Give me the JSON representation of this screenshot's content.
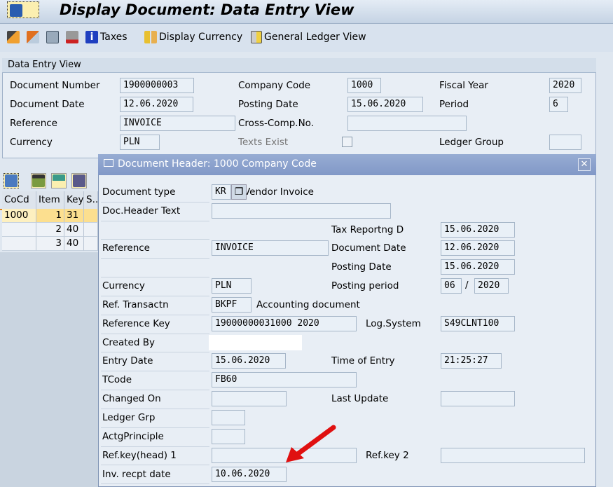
{
  "title": "Display Document: Data Entry View",
  "toolbar": {
    "taxes": "Taxes",
    "display_currency": "Display Currency",
    "gl_view": "General Ledger View"
  },
  "panel": {
    "heading": "Data Entry View",
    "document_number_label": "Document Number",
    "document_number": "1900000003",
    "company_code_label": "Company Code",
    "company_code": "1000",
    "fiscal_year_label": "Fiscal Year",
    "fiscal_year": "2020",
    "document_date_label": "Document Date",
    "document_date": "12.06.2020",
    "posting_date_label": "Posting Date",
    "posting_date": "15.06.2020",
    "period_label": "Period",
    "period": "6",
    "reference_label": "Reference",
    "reference": "INVOICE",
    "cross_comp_label": "Cross-Comp.No.",
    "cross_comp": "",
    "currency_label": "Currency",
    "currency": "PLN",
    "texts_exist_label": "Texts Exist",
    "texts_exist": false,
    "ledger_group_label": "Ledger Group",
    "ledger_group": ""
  },
  "table": {
    "headers": [
      "CoCd",
      "Item",
      "Key",
      "S..."
    ],
    "rows": [
      {
        "cocd": "1000",
        "item": "1",
        "key": "31"
      },
      {
        "cocd": "",
        "item": "2",
        "key": "40"
      },
      {
        "cocd": "",
        "item": "3",
        "key": "40"
      }
    ]
  },
  "dialog": {
    "title": "Document Header: 1000 Company Code",
    "document_type_label": "Document type",
    "document_type": "KR",
    "document_type_text": "Vendor Invoice",
    "header_text_label": "Doc.Header Text",
    "header_text": "",
    "tax_reporting_label": "Tax Reportng D",
    "tax_reporting": "15.06.2020",
    "reference_label": "Reference",
    "reference": "INVOICE",
    "document_date_label": "Document Date",
    "document_date": "12.06.2020",
    "posting_date_label": "Posting Date",
    "posting_date": "15.06.2020",
    "currency_label": "Currency",
    "currency": "PLN",
    "posting_period_label": "Posting period",
    "posting_period": "06",
    "posting_year": "2020",
    "ref_transaction_label": "Ref. Transactn",
    "ref_transaction": "BKPF",
    "ref_transaction_text": "Accounting document",
    "reference_key_label": "Reference Key",
    "reference_key": "19000000031000 2020",
    "log_system_label": "Log.System",
    "log_system": "S49CLNT100",
    "created_by_label": "Created By",
    "entry_date_label": "Entry Date",
    "entry_date": "15.06.2020",
    "time_of_entry_label": "Time of Entry",
    "time_of_entry": "21:25:27",
    "tcode_label": "TCode",
    "tcode": "FB60",
    "changed_on_label": "Changed On",
    "changed_on": "",
    "last_update_label": "Last Update",
    "last_update": "",
    "ledger_grp_label": "Ledger Grp",
    "ledger_grp": "",
    "actg_principle_label": "ActgPrinciple",
    "actg_principle": "",
    "ref_key_head1_label": "Ref.key(head) 1",
    "ref_key_head1": "",
    "ref_key2_label": "Ref.key 2",
    "ref_key2": "",
    "inv_receipt_date_label": "Inv. recpt date",
    "inv_receipt_date": "10.06.2020"
  },
  "colors": {
    "highlight_row": "#fcdf8f",
    "dialog_title": "#8198c7",
    "annotation_arrow": "#e01010"
  }
}
